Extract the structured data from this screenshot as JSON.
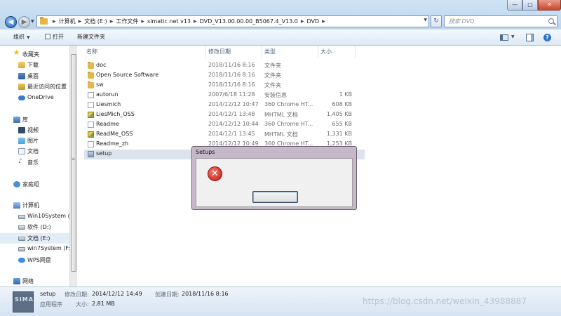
{
  "window": {
    "min_label": "—",
    "max_label": "□",
    "close_label": "✕"
  },
  "address": {
    "back_glyph": "◀",
    "fwd_glyph": "▶",
    "crumbs": [
      "计算机",
      "文档 (E:)",
      "工作文件",
      "simatic net v13",
      "DVD_V13.00.00.00_B5067.4_V13.0",
      "DVD"
    ],
    "search_placeholder": "搜索 DVD",
    "refresh_glyph": "↻"
  },
  "toolbar": {
    "organize_label": "组织",
    "open_label": "打开",
    "new_folder_label": "新建文件夹",
    "help_glyph": "?"
  },
  "sidebar": {
    "favorites": {
      "label": "收藏夹",
      "icon": "star-icon"
    },
    "fav_items": [
      {
        "label": "下载",
        "icon": "downloads-folder-icon"
      },
      {
        "label": "桌面",
        "icon": "desktop-icon"
      },
      {
        "label": "最近访问的位置",
        "icon": "recent-places-icon"
      }
    ],
    "onedrive": {
      "label": "OneDrive",
      "icon": "cloud-icon"
    },
    "libraries": {
      "label": "库",
      "icon": "library-icon"
    },
    "lib_items": [
      {
        "label": "视频",
        "icon": "video-icon"
      },
      {
        "label": "图片",
        "icon": "picture-icon"
      },
      {
        "label": "文档",
        "icon": "document-icon"
      },
      {
        "label": "音乐",
        "icon": "music-icon"
      }
    ],
    "homegroup": {
      "label": "家庭组",
      "icon": "homegroup-icon"
    },
    "computer": {
      "label": "计算机",
      "icon": "computer-icon"
    },
    "drives": [
      {
        "label": "Win10System (C:",
        "icon": "drive-icon"
      },
      {
        "label": "软件 (D:)",
        "icon": "drive-icon"
      },
      {
        "label": "文档 (E:)",
        "icon": "drive-icon",
        "selected": true
      },
      {
        "label": "win7System (F:)",
        "icon": "drive-icon"
      },
      {
        "label": "WPS网盘",
        "icon": "wps-cloud-icon"
      }
    ],
    "network": {
      "label": "网络",
      "icon": "network-icon"
    }
  },
  "filelist": {
    "columns": [
      "名称",
      "修改日期",
      "类型",
      "大小"
    ],
    "rows": [
      {
        "name": "doc",
        "date": "2018/11/16 8:16",
        "type": "文件夹",
        "size": "",
        "icon": "folder-icon"
      },
      {
        "name": "Open Source Software",
        "date": "2018/11/16 8:16",
        "type": "文件夹",
        "size": "",
        "icon": "folder-icon"
      },
      {
        "name": "sw",
        "date": "2018/11/16 8:16",
        "type": "文件夹",
        "size": "",
        "icon": "folder-icon"
      },
      {
        "name": "autorun",
        "date": "2007/6/18 11:28",
        "type": "安装信息",
        "size": "1 KB",
        "icon": "setup-info-icon"
      },
      {
        "name": "Liesmich",
        "date": "2014/12/12 10:47",
        "type": "360 Chrome HT...",
        "size": "608 KB",
        "icon": "document-icon"
      },
      {
        "name": "LiesMich_OSS",
        "date": "2014/12/1 13:48",
        "type": "MHTML 文档",
        "size": "1,405 KB",
        "icon": "mhtml-icon"
      },
      {
        "name": "Readme",
        "date": "2014/12/12 10:44",
        "type": "360 Chrome HT...",
        "size": "655 KB",
        "icon": "document-icon"
      },
      {
        "name": "ReadMe_OSS",
        "date": "2014/12/1 13:45",
        "type": "MHTML 文档",
        "size": "1,331 KB",
        "icon": "mhtml-icon"
      },
      {
        "name": "Readme_zh",
        "date": "2014/12/12 10:49",
        "type": "360 Chrome HT...",
        "size": "1,253 KB",
        "icon": "document-icon"
      },
      {
        "name": "setup",
        "date": "",
        "type": "",
        "size": "",
        "icon": "setup-app-icon",
        "selected": true
      }
    ]
  },
  "dialog": {
    "title": "Setups",
    "icon": "error-icon",
    "error_glyph": "✕",
    "ok_label": ""
  },
  "details": {
    "thumb_text": "SIMA",
    "name": "setup",
    "type": "应用程序",
    "modified_label": "修改日期:",
    "modified_value": "2014/12/12 14:49",
    "size_label": "大小:",
    "size_value": "2.81 MB",
    "created_label": "创建日期:",
    "created_value": "2018/11/16 8:16"
  },
  "watermark": "https://blog.csdn.net/weixin_43988887"
}
